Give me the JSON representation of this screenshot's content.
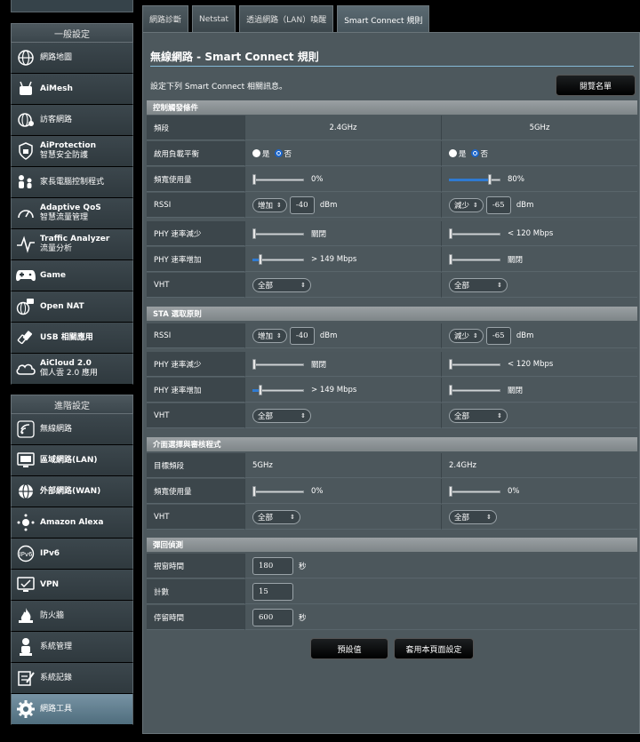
{
  "sidebar": {
    "general_header": "一般設定",
    "advanced_header": "進階設定",
    "general_items": [
      {
        "label": "網路地圖",
        "sub": ""
      },
      {
        "label": "AiMesh",
        "sub": ""
      },
      {
        "label": "訪客網路",
        "sub": ""
      },
      {
        "label": "AiProtection",
        "sub": "智慧安全防護"
      },
      {
        "label": "家長電腦控制程式",
        "sub": ""
      },
      {
        "label": "Adaptive QoS",
        "sub": "智慧流量管理"
      },
      {
        "label": "Traffic Analyzer",
        "sub": "流量分析"
      },
      {
        "label": "Game",
        "sub": ""
      },
      {
        "label": "Open NAT",
        "sub": ""
      },
      {
        "label": "USB 相關應用",
        "sub": ""
      },
      {
        "label": "AiCloud 2.0",
        "sub": "個人雲 2.0 應用"
      }
    ],
    "advanced_items": [
      {
        "label": "無線網路"
      },
      {
        "label": "區域網路(LAN)"
      },
      {
        "label": "外部網路(WAN)"
      },
      {
        "label": "Amazon Alexa"
      },
      {
        "label": "IPv6"
      },
      {
        "label": "VPN"
      },
      {
        "label": "防火牆"
      },
      {
        "label": "系統管理"
      },
      {
        "label": "系統記錄"
      },
      {
        "label": "網路工具"
      }
    ]
  },
  "tabs": [
    "網路診斷",
    "Netstat",
    "透過網路（LAN）喚醒",
    "Smart Connect 規則"
  ],
  "page": {
    "title": "無線網路 - Smart Connect 規則",
    "description": "設定下列 Smart Connect 相關訊息。",
    "browse_button": "閱覽名單",
    "default_button": "預設值",
    "apply_button": "套用本頁面設定"
  },
  "sections": {
    "trigger": {
      "title": "控制觸發條件",
      "band_label": "頻段",
      "band_24": "2.4GHz",
      "band_5": "5GHz",
      "load_balance_label": "啟用負載平衡",
      "yes": "是",
      "no": "否",
      "bw_label": "頻寬使用量",
      "bw_24": "0%",
      "bw_24_level": 0,
      "bw_5": "80%",
      "bw_5_level": 0.8,
      "rssi_label": "RSSI",
      "rssi_24_op": "增加",
      "rssi_24_val": "-40",
      "rssi_5_op": "減少",
      "rssi_5_val": "-65",
      "rssi_unit": "dBm",
      "phy_dec_label": "PHY 速率減少",
      "phy_dec_24": "關閉",
      "phy_dec_5": "< 120 Mbps",
      "phy_inc_label": "PHY 速率增加",
      "phy_inc_24": "> 149 Mbps",
      "phy_inc_5": "關閉",
      "vht_label": "VHT",
      "vht_24": "全部",
      "vht_5": "全部"
    },
    "sta": {
      "title": "STA 選取原則",
      "rssi_label": "RSSI",
      "rssi_24_op": "增加",
      "rssi_24_val": "-40",
      "rssi_5_op": "減少",
      "rssi_5_val": "-65",
      "rssi_unit": "dBm",
      "phy_dec_label": "PHY 速率減少",
      "phy_dec_24": "關閉",
      "phy_dec_5": "< 120 Mbps",
      "phy_inc_label": "PHY 速率增加",
      "phy_inc_24": "> 149 Mbps",
      "phy_inc_5": "關閉",
      "vht_label": "VHT",
      "vht_24": "全部",
      "vht_5": "全部"
    },
    "iface": {
      "title": "介面選擇與審核程式",
      "target_label": "目標頻段",
      "target_24": "5GHz",
      "target_5": "2.4GHz",
      "bw_label": "頻寬使用量",
      "bw_24": "0%",
      "bw_5": "0%",
      "vht_label": "VHT",
      "vht_24": "全部",
      "vht_5": "全部"
    },
    "bounce": {
      "title": "彈回偵測",
      "window_label": "視窗時間",
      "window_val": "180",
      "sec": "秒",
      "count_label": "計數",
      "count_val": "15",
      "dwell_label": "停留時間",
      "dwell_val": "600"
    }
  },
  "colors": {
    "accent": "#1a64c9",
    "title_rule": "#86bad8",
    "active_menu": "#6f8b9b"
  }
}
